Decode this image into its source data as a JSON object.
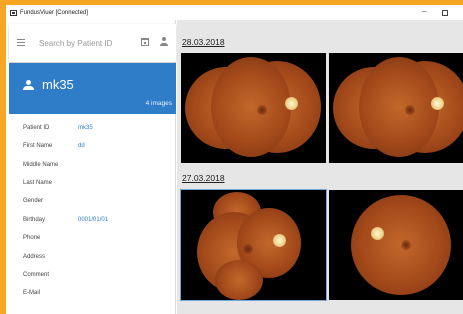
{
  "window": {
    "title": "FundusViuer [Connected]",
    "minimize": "–"
  },
  "search": {
    "placeholder": "Search by Patient ID"
  },
  "patient": {
    "name": "mk35",
    "image_count": "4 images"
  },
  "fields": [
    {
      "label": "Patient ID",
      "value": "mk35"
    },
    {
      "label": "First Name",
      "value": "dd"
    },
    {
      "label": "Middle Name",
      "value": ""
    },
    {
      "label": "Last Name",
      "value": ""
    },
    {
      "label": "Gender",
      "value": ""
    },
    {
      "label": "Birthday",
      "value": "0001/01/01"
    },
    {
      "label": "Phone",
      "value": ""
    },
    {
      "label": "Address",
      "value": ""
    },
    {
      "label": "Comment",
      "value": ""
    },
    {
      "label": "E-Mail",
      "value": ""
    }
  ],
  "sessions": [
    {
      "date": "28.03.2018"
    },
    {
      "date": "27.03.2018"
    }
  ],
  "colors": {
    "accent": "#2f7cc9",
    "window_frame": "#f5a623",
    "content_bg": "#e6e6e6"
  },
  "icons": [
    "menu-icon",
    "calendar-icon",
    "person-search-icon",
    "person-icon"
  ]
}
